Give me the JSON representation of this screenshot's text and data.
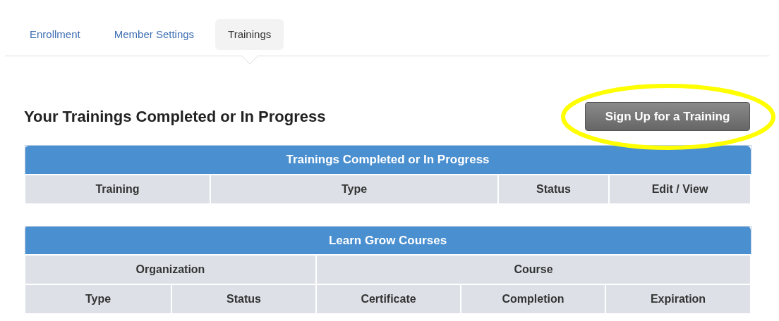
{
  "tabs": [
    {
      "label": "Enrollment",
      "selected": false
    },
    {
      "label": "Member Settings",
      "selected": false
    },
    {
      "label": "Trainings",
      "selected": true
    }
  ],
  "heading": "Your Trainings Completed or In Progress",
  "sign_up_button": {
    "label": "Sign Up for a Training",
    "highlighted": true
  },
  "tables": [
    {
      "title": "Trainings Completed or In Progress",
      "columns": [
        {
          "label": "Training"
        },
        {
          "label": "Type"
        },
        {
          "label": "Status"
        },
        {
          "label": "Edit / View"
        }
      ]
    },
    {
      "title": "Learn Grow Courses",
      "columns": [
        {
          "label": "Organization",
          "children": [
            {
              "label": "Type"
            },
            {
              "label": "Status"
            }
          ]
        },
        {
          "label": "Course",
          "children": [
            {
              "label": "Certificate"
            },
            {
              "label": "Completion"
            },
            {
              "label": "Expiration"
            }
          ]
        }
      ]
    }
  ]
}
